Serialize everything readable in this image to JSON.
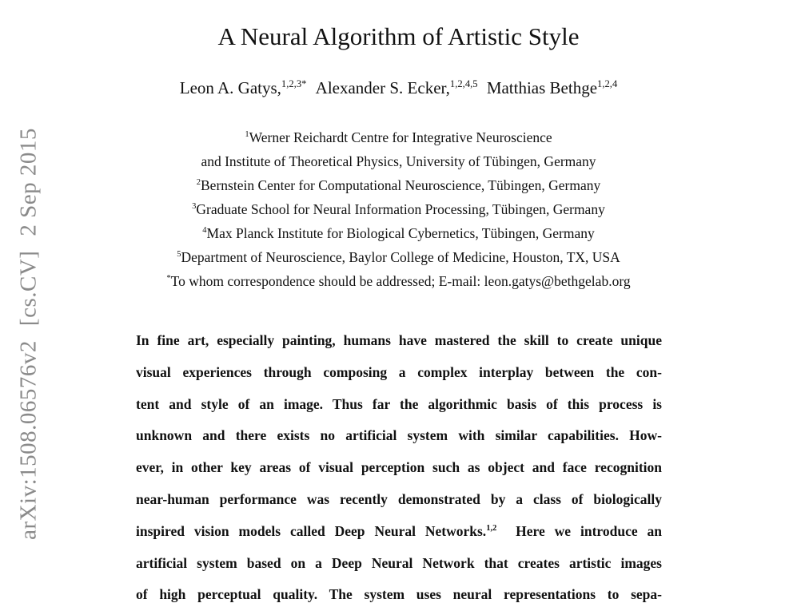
{
  "watermark": {
    "id": "arXiv:1508.06576v2",
    "category": "[cs.CV]",
    "date": "2 Sep 2015"
  },
  "title": "A Neural Algorithm of Artistic Style",
  "authors": [
    {
      "name": "Leon A. Gatys,",
      "sup": "1,2,3*"
    },
    {
      "name": "Alexander S. Ecker,",
      "sup": "1,2,4,5"
    },
    {
      "name": "Matthias Bethge",
      "sup": "1,2,4"
    }
  ],
  "affiliations": [
    {
      "sup": "1",
      "text": "Werner Reichardt Centre for Integrative Neuroscience"
    },
    {
      "sup": "",
      "text": "and Institute of Theoretical Physics, University of Tübingen, Germany"
    },
    {
      "sup": "2",
      "text": "Bernstein Center for Computational Neuroscience, Tübingen, Germany"
    },
    {
      "sup": "3",
      "text": "Graduate School for Neural Information Processing, Tübingen, Germany"
    },
    {
      "sup": "4",
      "text": "Max Planck Institute for Biological Cybernetics, Tübingen, Germany"
    },
    {
      "sup": "5",
      "text": "Department of Neuroscience, Baylor College of Medicine, Houston, TX, USA"
    },
    {
      "sup": "*",
      "text": "To whom correspondence should be addressed; E-mail: leon.gatys@bethgelab.org"
    }
  ],
  "abstract_lines": [
    "In fine art, especially painting, humans have mastered the skill to create unique",
    "visual experiences through composing a complex interplay between the con-",
    "tent and style of an image.  Thus far the algorithmic basis of this process is",
    "unknown and there exists no artificial system with similar capabilities.  How-",
    "ever, in other key areas of visual perception such as object and face recognition",
    "near-human performance was recently demonstrated by a class of biologically",
    "inspired vision models called Deep Neural Networks.",
    "artificial system based on a Deep Neural Network that creates artistic images",
    "of high perceptual quality.  The system uses neural representations to sepa-"
  ],
  "abstract_citation": "1,2",
  "abstract_line7_tail": "Here we introduce an"
}
